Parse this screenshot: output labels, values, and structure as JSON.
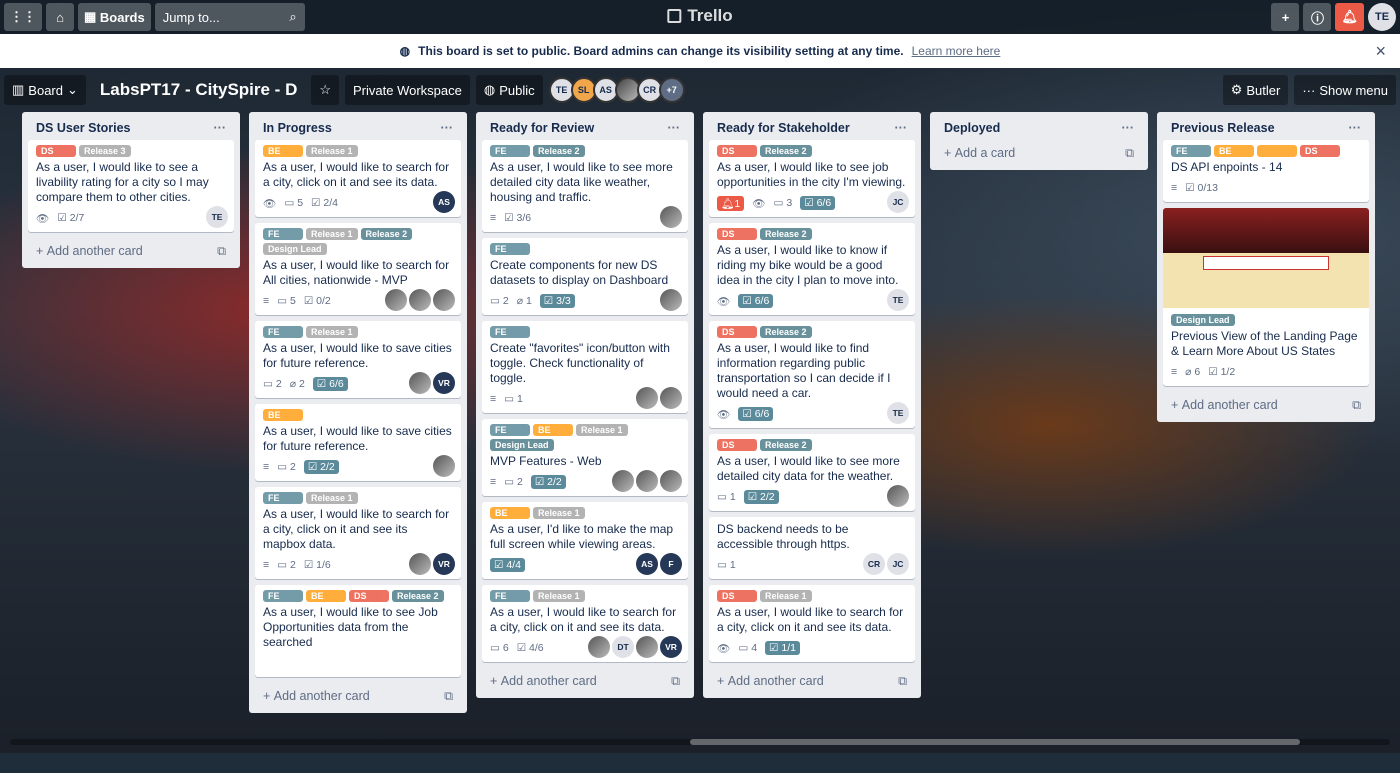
{
  "topnav": {
    "boards_label": "Boards",
    "jump_label": "Jump to...",
    "logo": "Trello",
    "user_initials": "TE"
  },
  "banner": {
    "text": "This board is set to public. Board admins can change its visibility setting at any time.",
    "link": "Learn more here",
    "close": "×"
  },
  "header": {
    "board_btn": "Board",
    "title": "LabsPT17 - CitySpire - D",
    "workspace": "Private Workspace",
    "visibility": "Public",
    "members": [
      "TE",
      "SL",
      "AS",
      "",
      "CR"
    ],
    "more_members": "+7",
    "butler": "Butler",
    "menu": "Show menu"
  },
  "lists": [
    {
      "name": "DS User Stories",
      "add": "Add another card",
      "cards": [
        {
          "labels": [
            {
              "c": "red",
              "t": "DS"
            },
            {
              "c": "grey",
              "t": "Release 3"
            }
          ],
          "title": "As a user, I would like to see a livability rating for a city so I may compare them to other cities.",
          "badges": [
            {
              "k": "eye",
              "t": ""
            },
            {
              "k": "chk",
              "t": "2/7"
            }
          ],
          "avatars": [
            "TE"
          ]
        }
      ]
    },
    {
      "name": "In Progress",
      "add": "Add another card",
      "cards": [
        {
          "labels": [
            {
              "c": "orange",
              "t": "BE"
            },
            {
              "c": "grey",
              "t": "Release 1"
            }
          ],
          "title": "As a user, I would like to search for a city, click on it and see its data.",
          "badges": [
            {
              "k": "eye",
              "t": ""
            },
            {
              "k": "com",
              "t": "5"
            },
            {
              "k": "chk",
              "t": "2/4"
            }
          ],
          "avatars": [
            "AS"
          ]
        },
        {
          "labels": [
            {
              "c": "blue",
              "t": "FE"
            },
            {
              "c": "grey",
              "t": "Release 1"
            },
            {
              "c": "teal",
              "t": "Release 2"
            },
            {
              "c": "grey",
              "t": "Design Lead"
            }
          ],
          "title": "As a user, I would like to search for All cities, nationwide - MVP",
          "badges": [
            {
              "k": "desc",
              "t": ""
            },
            {
              "k": "com",
              "t": "5"
            },
            {
              "k": "chk",
              "t": "0/2"
            }
          ],
          "avatars": [
            "img",
            "img",
            "img"
          ]
        },
        {
          "labels": [
            {
              "c": "blue",
              "t": "FE"
            },
            {
              "c": "grey",
              "t": "Release 1"
            }
          ],
          "title": "As a user, I would like to save cities for future reference.",
          "badges": [
            {
              "k": "com",
              "t": "2"
            },
            {
              "k": "att",
              "t": "2"
            },
            {
              "k": "chkdk",
              "t": "6/6"
            }
          ],
          "avatars": [
            "img",
            "VR"
          ]
        },
        {
          "labels": [
            {
              "c": "orange",
              "t": "BE"
            }
          ],
          "title": "As a user, I would like to save cities for future reference.",
          "badges": [
            {
              "k": "desc",
              "t": ""
            },
            {
              "k": "com",
              "t": "2"
            },
            {
              "k": "chkdk",
              "t": "2/2"
            }
          ],
          "avatars": [
            "img"
          ]
        },
        {
          "labels": [
            {
              "c": "blue",
              "t": "FE"
            },
            {
              "c": "grey",
              "t": "Release 1"
            }
          ],
          "title": "As a user, I would like to search for a city, click on it and see its mapbox data.",
          "badges": [
            {
              "k": "desc",
              "t": ""
            },
            {
              "k": "com",
              "t": "2"
            },
            {
              "k": "chk",
              "t": "1/6"
            }
          ],
          "avatars": [
            "img",
            "VR"
          ]
        },
        {
          "labels": [
            {
              "c": "blue",
              "t": "FE"
            },
            {
              "c": "orange",
              "t": "BE"
            },
            {
              "c": "red",
              "t": "DS"
            },
            {
              "c": "teal",
              "t": "Release 2"
            }
          ],
          "title": "As a user, I would like to see Job Opportunities data from the searched",
          "badges": [],
          "avatars": []
        }
      ]
    },
    {
      "name": "Ready for Review",
      "add": "Add another card",
      "cards": [
        {
          "labels": [
            {
              "c": "blue",
              "t": "FE"
            },
            {
              "c": "teal",
              "t": "Release 2"
            }
          ],
          "title": "As a user, I would like to see more detailed city data like weather, housing and traffic.",
          "badges": [
            {
              "k": "desc",
              "t": ""
            },
            {
              "k": "chk",
              "t": "3/6"
            }
          ],
          "avatars": [
            "img"
          ]
        },
        {
          "labels": [
            {
              "c": "blue",
              "t": "FE"
            }
          ],
          "title": "Create components for new DS datasets to display on Dashboard",
          "badges": [
            {
              "k": "com",
              "t": "2"
            },
            {
              "k": "att",
              "t": "1"
            },
            {
              "k": "chkdk",
              "t": "3/3"
            }
          ],
          "avatars": [
            "img"
          ]
        },
        {
          "labels": [
            {
              "c": "blue",
              "t": "FE"
            }
          ],
          "title": "Create \"favorites\" icon/button with toggle. Check functionality of toggle.",
          "badges": [
            {
              "k": "desc",
              "t": ""
            },
            {
              "k": "com",
              "t": "1"
            }
          ],
          "avatars": [
            "img",
            "img"
          ]
        },
        {
          "labels": [
            {
              "c": "blue",
              "t": "FE"
            },
            {
              "c": "orange",
              "t": "BE"
            },
            {
              "c": "grey",
              "t": "Release 1"
            },
            {
              "c": "teal",
              "t": "Design Lead"
            }
          ],
          "title": "MVP Features - Web",
          "badges": [
            {
              "k": "desc",
              "t": ""
            },
            {
              "k": "com",
              "t": "2"
            },
            {
              "k": "chkdk",
              "t": "2/2"
            }
          ],
          "avatars": [
            "img",
            "img",
            "img"
          ]
        },
        {
          "labels": [
            {
              "c": "orange",
              "t": "BE"
            },
            {
              "c": "grey",
              "t": "Release 1"
            }
          ],
          "title": "As a user, I'd like to make the map full screen while viewing areas.",
          "badges": [
            {
              "k": "chkdk",
              "t": "4/4"
            }
          ],
          "avatars": [
            "AS",
            "F"
          ]
        },
        {
          "labels": [
            {
              "c": "blue",
              "t": "FE"
            },
            {
              "c": "grey",
              "t": "Release 1"
            }
          ],
          "title": "As a user, I would like to search for a city, click on it and see its data.",
          "badges": [
            {
              "k": "com",
              "t": "6"
            },
            {
              "k": "chk",
              "t": "4/6"
            }
          ],
          "avatars": [
            "img",
            "DT",
            "img",
            "VR"
          ]
        }
      ]
    },
    {
      "name": "Ready for Stakeholder",
      "add": "Add another card",
      "cards": [
        {
          "labels": [
            {
              "c": "red",
              "t": "DS"
            },
            {
              "c": "teal",
              "t": "Release 2"
            }
          ],
          "title": "As a user, I would like to see job opportunities in the city I'm viewing.",
          "badges": [
            {
              "k": "not",
              "t": "1"
            },
            {
              "k": "eye",
              "t": ""
            },
            {
              "k": "com",
              "t": "3"
            },
            {
              "k": "chkdk",
              "t": "6/6"
            }
          ],
          "avatars": [
            "JC"
          ]
        },
        {
          "labels": [
            {
              "c": "red",
              "t": "DS"
            },
            {
              "c": "teal",
              "t": "Release 2"
            }
          ],
          "title": "As a user, I would like to know if riding my bike would be a good idea in the city I plan to move into.",
          "badges": [
            {
              "k": "eye",
              "t": ""
            },
            {
              "k": "chkdk",
              "t": "6/6"
            }
          ],
          "avatars": [
            "TE"
          ]
        },
        {
          "labels": [
            {
              "c": "red",
              "t": "DS"
            },
            {
              "c": "teal",
              "t": "Release 2"
            }
          ],
          "title": "As a user, I would like to find information regarding public transportation so I can decide if I would need a car.",
          "badges": [
            {
              "k": "eye",
              "t": ""
            },
            {
              "k": "chkdk",
              "t": "6/6"
            }
          ],
          "avatars": [
            "TE"
          ]
        },
        {
          "labels": [
            {
              "c": "red",
              "t": "DS"
            },
            {
              "c": "teal",
              "t": "Release 2"
            }
          ],
          "title": "As a user, I would like to see more detailed city data for the weather.",
          "badges": [
            {
              "k": "com",
              "t": "1"
            },
            {
              "k": "chkdk",
              "t": "2/2"
            }
          ],
          "avatars": [
            "img"
          ]
        },
        {
          "labels": [],
          "title": "DS backend needs to be accessible through https.",
          "badges": [
            {
              "k": "com",
              "t": "1"
            }
          ],
          "avatars": [
            "CR",
            "JC"
          ]
        },
        {
          "labels": [
            {
              "c": "red",
              "t": "DS"
            },
            {
              "c": "grey",
              "t": "Release 1"
            }
          ],
          "title": "As a user, I would like to search for a city, click on it and see its data.",
          "badges": [
            {
              "k": "eye",
              "t": ""
            },
            {
              "k": "com",
              "t": "4"
            },
            {
              "k": "chkdk",
              "t": "1/1"
            }
          ],
          "avatars": []
        }
      ]
    },
    {
      "name": "Deployed",
      "add": "Add a card",
      "cards": []
    },
    {
      "name": "Previous Release",
      "add": "Add another card",
      "cards": [
        {
          "labels": [
            {
              "c": "blue",
              "t": "FE"
            },
            {
              "c": "orange",
              "t": "BE"
            },
            {
              "c": "orange",
              "t": ""
            },
            {
              "c": "red",
              "t": "DS"
            }
          ],
          "title": "DS API enpoints - 14",
          "badges": [
            {
              "k": "desc",
              "t": ""
            },
            {
              "k": "chk",
              "t": "0/13"
            }
          ],
          "avatars": []
        },
        {
          "cover": true,
          "labels": [
            {
              "c": "teal",
              "t": "Design Lead"
            }
          ],
          "title": "Previous View of the Landing Page & Learn More About US States",
          "badges": [
            {
              "k": "desc",
              "t": ""
            },
            {
              "k": "att",
              "t": "6"
            },
            {
              "k": "chk",
              "t": "1/2"
            }
          ],
          "avatars": []
        }
      ]
    }
  ]
}
